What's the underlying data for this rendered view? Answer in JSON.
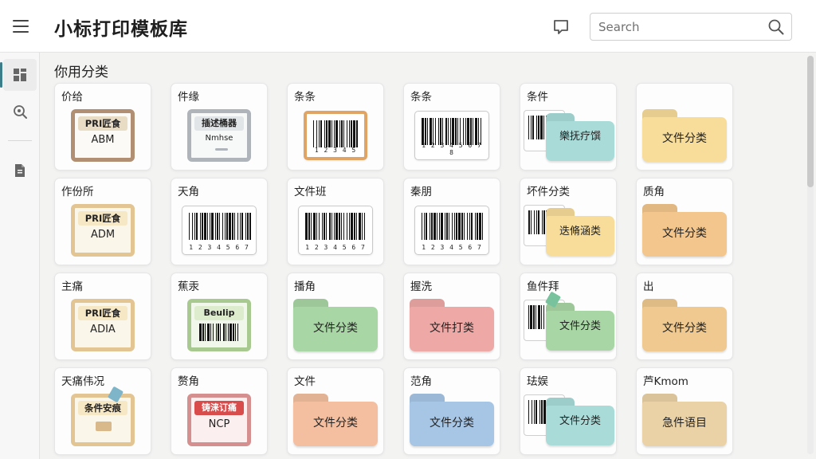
{
  "header": {
    "title": "小标打印模板库",
    "search": {
      "placeholder": "Search",
      "value": ""
    }
  },
  "section": {
    "title": "你用分类"
  },
  "icons": {
    "menu": "hamburger-menu-icon",
    "feedback": "chat-bubble-icon",
    "search": "search-icon",
    "sidebar": [
      "templates-grid-icon",
      "zoom-search-icon",
      "document-icon"
    ]
  },
  "colors": {
    "accent": "#3c7d8a",
    "folder_yellow": "#f7dc9a",
    "folder_orange": "#f2c68c",
    "folder_green": "#a9d6a5",
    "folder_pink": "#eea9a6",
    "folder_blue": "#a7c6e6",
    "folder_teal": "#a9dcd9",
    "folder_peach": "#f3bfa0",
    "folder_sand": "#ead1a6",
    "folder_gold": "#efc98f"
  },
  "cards": [
    {
      "label": "价给",
      "kind": "tag",
      "variant": "brown",
      "header": "PRI匠食",
      "text": "ABM"
    },
    {
      "label": "件缘",
      "kind": "tag",
      "variant": "gray",
      "header": "插述桶器",
      "text": "Nmhse"
    },
    {
      "label": "条条",
      "kind": "barcode",
      "variant": "framed",
      "digits": "1 2 3 4 5"
    },
    {
      "label": "条条",
      "kind": "barcode",
      "variant": "plain",
      "digits": "1 2 3 4 5 6 7 8"
    },
    {
      "label": "条件",
      "kind": "combo",
      "folder_text": "樂抚疗馔",
      "folder_color": "#a9dcd9"
    },
    {
      "label": "",
      "kind": "folder",
      "folder_text": "文件分类",
      "folder_color": "#f7dc9a"
    },
    {
      "label": "作份所",
      "kind": "tag",
      "variant": "cream",
      "header": "PRI匠食",
      "text": "ADM"
    },
    {
      "label": "天角",
      "kind": "barcode",
      "variant": "plain",
      "digits": "1 2 3 4 5 6 7"
    },
    {
      "label": "文件班",
      "kind": "barcode",
      "variant": "plain",
      "digits": "1 2 3 4 5 6 7"
    },
    {
      "label": "秦朋",
      "kind": "barcode",
      "variant": "plain",
      "digits": "1 2 3 4 5 6 7"
    },
    {
      "label": "坏件分类",
      "kind": "combo",
      "folder_text": "迭脩涵类",
      "folder_color": "#f7dc9a"
    },
    {
      "label": "质角",
      "kind": "folder",
      "folder_text": "文件分类",
      "folder_color": "#f2c68c"
    },
    {
      "label": "主痛",
      "kind": "tag",
      "variant": "cream",
      "header": "PRI匠食",
      "text": "ADIA"
    },
    {
      "label": "蕉汞",
      "kind": "tag",
      "variant": "green",
      "header": "Beulip",
      "text": ""
    },
    {
      "label": "播角",
      "kind": "folder",
      "folder_text": "文件分类",
      "folder_color": "#a9d6a5"
    },
    {
      "label": "握洗",
      "kind": "folder",
      "folder_text": "文件打类",
      "folder_color": "#eea9a6"
    },
    {
      "label": "鱼件拜",
      "kind": "combo",
      "folder_text": "文件分类",
      "folder_color": "#a9d6a5"
    },
    {
      "label": "出",
      "kind": "folder",
      "folder_text": "文件分类",
      "folder_color": "#efc98f"
    },
    {
      "label": "天痛伟况",
      "kind": "tag",
      "variant": "cream",
      "header": "条件安痕",
      "text": ""
    },
    {
      "label": "赘角",
      "kind": "tag",
      "variant": "red",
      "header": "铸涞订痛",
      "text": "NCP"
    },
    {
      "label": "文件",
      "kind": "folder",
      "folder_text": "文件分类",
      "folder_color": "#f3bfa0"
    },
    {
      "label": "范角",
      "kind": "folder",
      "folder_text": "文件分类",
      "folder_color": "#a7c6e6"
    },
    {
      "label": "珐娱",
      "kind": "combo",
      "folder_text": "文件分类",
      "folder_color": "#a9dcd9"
    },
    {
      "label": "芦Kmom",
      "kind": "folder",
      "folder_text": "急件语目",
      "folder_color": "#ead1a6"
    }
  ]
}
